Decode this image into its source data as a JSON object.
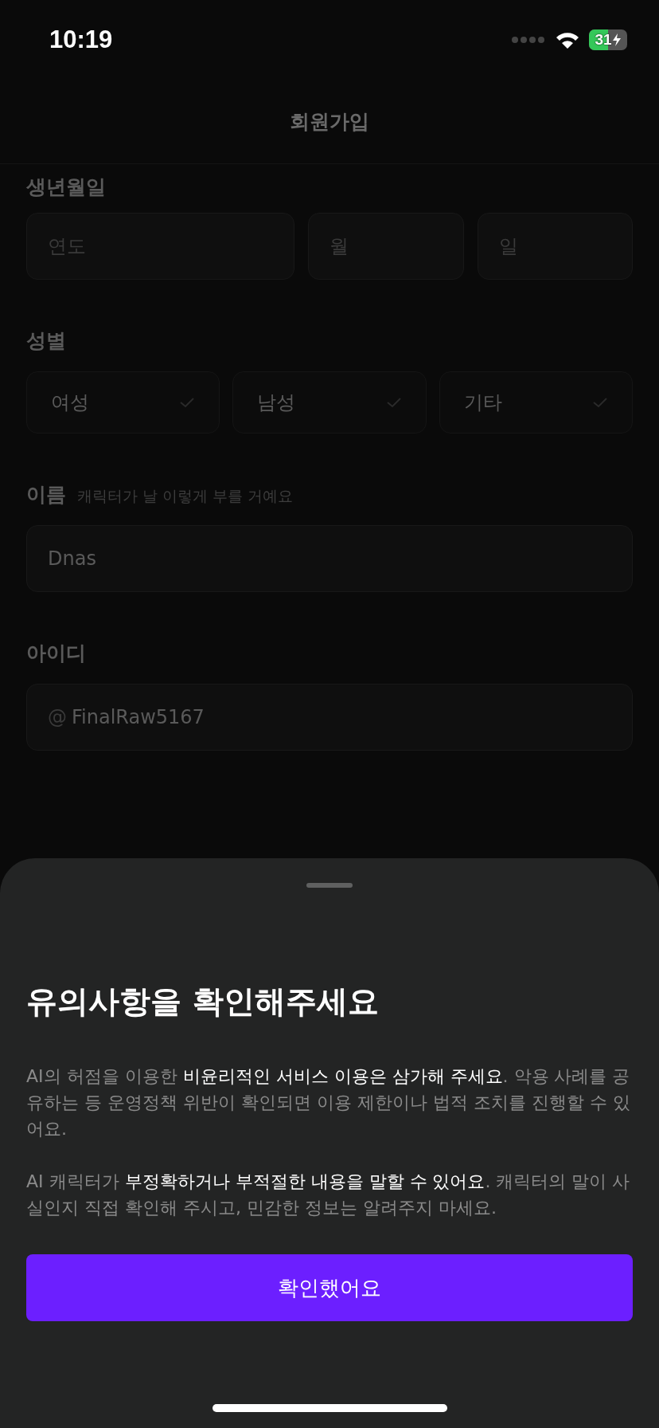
{
  "status_bar": {
    "time": "10:19",
    "battery": "31"
  },
  "header": {
    "title": "회원가입"
  },
  "birth": {
    "label": "생년월일",
    "fields": [
      {
        "placeholder": "연도"
      },
      {
        "placeholder": "월"
      },
      {
        "placeholder": "일"
      }
    ]
  },
  "gender": {
    "label": "성별",
    "options": [
      {
        "label": "여성",
        "selected": false
      },
      {
        "label": "남성",
        "selected": false
      },
      {
        "label": "기타",
        "selected": false
      }
    ]
  },
  "name": {
    "label": "이름",
    "hint": "캐릭터가 날 이렇게 부를 거예요",
    "value": "Dnas"
  },
  "user_id": {
    "label": "아이디",
    "prefix": "@",
    "value": "FinalRaw5167"
  },
  "sheet": {
    "title": "유의사항을 확인해주세요",
    "paragraphs": [
      "AI의 허점을 이용한 **비윤리적인 서비스 이용은 삼가해 주세요**. 악용 사례를 공유하는 등 운영정책 위반이 확인되면 이용 제한이나 법적 조치를 진행할 수 있어요.",
      "AI 캐릭터가 **부정확하거나 부적절한 내용을 말할 수 있어요**. 캐릭터의 말이 사실인지 직접 확인해 주시고, 민감한 정보는 알려주지 마세요."
    ],
    "button": "확인했어요"
  }
}
